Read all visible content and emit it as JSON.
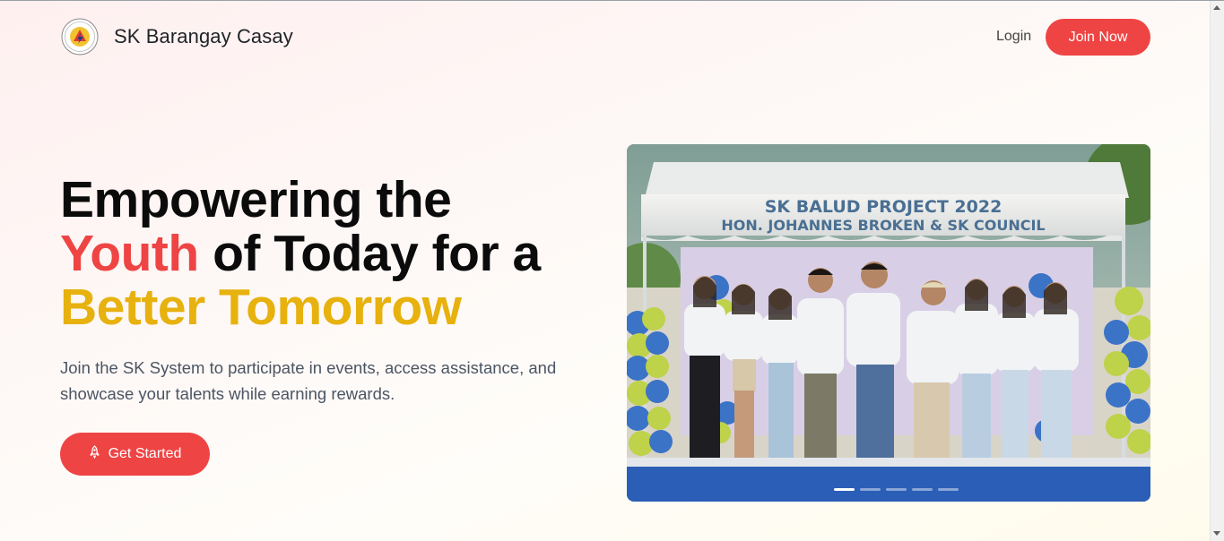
{
  "header": {
    "brand": "SK Barangay Casay",
    "login_label": "Login",
    "join_label": "Join Now"
  },
  "hero": {
    "line1": "Empowering the",
    "line2_highlight": "Youth",
    "line2_rest": " of Today for a",
    "line3": "Better Tomorrow",
    "subtitle": "Join the SK System to participate in events, access assistance, and showcase your talents while earning rewards.",
    "cta_label": "Get Started",
    "cta_icon": "rocket-icon"
  },
  "carousel": {
    "banner_line1": "SK BALUD PROJECT 2022",
    "banner_line2": "HON. JOHANNES BROKEN & SK COUNCIL",
    "slide_count": 5,
    "active_slide": 1
  },
  "colors": {
    "accent_red": "#ef4444",
    "accent_gold": "#e7b10e"
  }
}
